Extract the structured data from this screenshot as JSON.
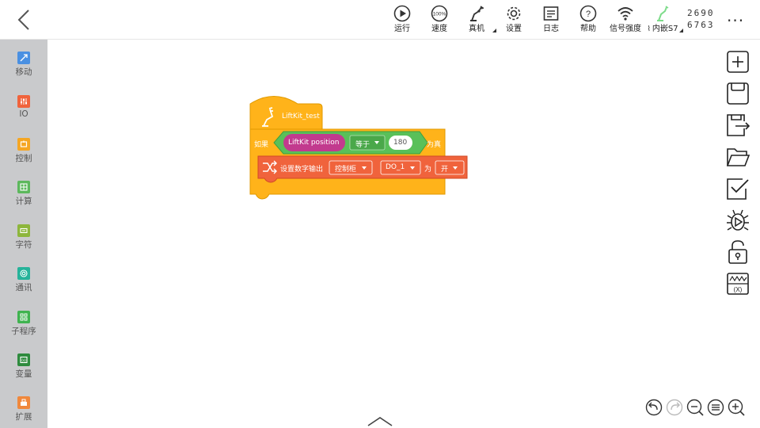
{
  "toolbar": {
    "items": [
      {
        "label": "运行",
        "icon": "play-icon"
      },
      {
        "label": "速度",
        "icon": "speedometer-icon"
      },
      {
        "label": "真机",
        "icon": "robot-arm-icon"
      },
      {
        "label": "设置",
        "icon": "gear-icon"
      },
      {
        "label": "日志",
        "icon": "log-icon"
      },
      {
        "label": "帮助",
        "icon": "help-icon"
      },
      {
        "label": "信号强度",
        "icon": "wifi-icon"
      },
      {
        "label": "内嵌S7",
        "icon": "robot-arm-green-icon"
      }
    ],
    "speed_value": "100%",
    "device_id_line1": "2690",
    "device_id_line2": "6763",
    "more": "···"
  },
  "sidebar": {
    "items": [
      {
        "label": "移动",
        "color": "#4a90e2"
      },
      {
        "label": "IO",
        "color": "#f0633c"
      },
      {
        "label": "控制",
        "color": "#f5a623"
      },
      {
        "label": "计算",
        "color": "#5cb85c"
      },
      {
        "label": "字符",
        "color": "#8db63c"
      },
      {
        "label": "通讯",
        "color": "#26b39a"
      },
      {
        "label": "子程序",
        "color": "#3fb34f"
      },
      {
        "label": "变量",
        "color": "#2e8b3e"
      },
      {
        "label": "扩展",
        "color": "#f0883c"
      }
    ]
  },
  "blocks": {
    "hat_label": "LiftKit_test",
    "if_label": "如果",
    "then_label": "为真",
    "reporter_label": "LiftKit  position",
    "compare_op": "等于",
    "compare_value": "180",
    "action_label": "设置数字输出",
    "action_target": "控制柜",
    "action_port": "DO_1",
    "action_as": "为",
    "action_state": "开",
    "colors": {
      "control": "#ffb31a",
      "logic": "#59c059",
      "reporter": "#c23a8e",
      "io": "#f0633c"
    }
  },
  "right_tools": [
    "new-file-icon",
    "save-icon",
    "save-as-icon",
    "open-folder-icon",
    "checklist-icon",
    "debug-icon",
    "unlock-icon",
    "variable-monitor-icon"
  ],
  "zoom_controls": [
    "undo-icon",
    "redo-icon",
    "zoom-out-icon",
    "reset-zoom-icon",
    "zoom-in-icon"
  ]
}
